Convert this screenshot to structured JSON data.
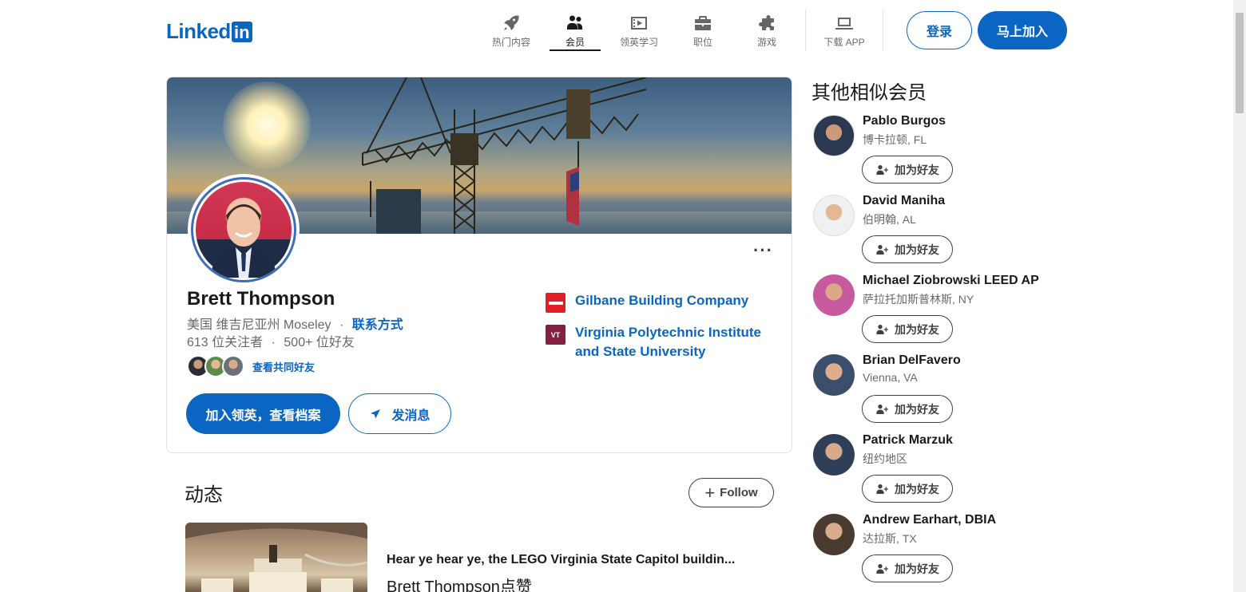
{
  "header": {
    "logo_text": "Linked",
    "logo_in": "in",
    "nav": [
      {
        "label": "热门内容",
        "icon": "rocket-icon"
      },
      {
        "label": "会员",
        "icon": "people-icon",
        "active": true
      },
      {
        "label": "领英学习",
        "icon": "video-play-icon"
      },
      {
        "label": "职位",
        "icon": "briefcase-icon"
      },
      {
        "label": "游戏",
        "icon": "puzzle-icon"
      },
      {
        "label": "下载 APP",
        "icon": "laptop-icon"
      }
    ],
    "login_label": "登录",
    "join_label": "马上加入"
  },
  "profile": {
    "name": "Brett Thompson",
    "location": "美国 维吉尼亚州 Moseley",
    "separator": "·",
    "contact_label": "联系方式",
    "followers": "613 位关注者",
    "connections": "500+ 位好友",
    "mutual_link": "查看共同好友",
    "primary_button": "加入领英，查看档案",
    "message_button": "发消息",
    "more_label": "···",
    "organizations": [
      {
        "name": "Gilbane Building Company",
        "logo": "gilbane-logo",
        "color": "#e41e26"
      },
      {
        "name": "Virginia Polytechnic Institute and State University",
        "logo": "vt-logo",
        "logo_text": "VT",
        "color": "#861f41"
      }
    ]
  },
  "activity": {
    "title": "动态",
    "follow_label": "Follow",
    "follow_plus": "+",
    "post_title": "Hear ye hear ye, the LEGO Virginia State Capitol buildin...",
    "post_sub": "Brett Thompson点赞"
  },
  "sidebar": {
    "title": "其他相似会员",
    "add_label": "加为好友",
    "people": [
      {
        "name": "Pablo Burgos",
        "location": "博卡拉顿, FL"
      },
      {
        "name": "David Maniha",
        "location": "伯明翰, AL"
      },
      {
        "name": "Michael Ziobrowski LEED AP",
        "location": "萨拉托加斯普林斯, NY"
      },
      {
        "name": "Brian DelFavero",
        "location": "Vienna, VA"
      },
      {
        "name": "Patrick Marzuk",
        "location": "纽约地区"
      },
      {
        "name": "Andrew Earhart, DBIA",
        "location": "达拉斯, TX"
      }
    ]
  },
  "colors": {
    "brand": "#0a66c2",
    "text": "#191919",
    "muted": "#666666"
  }
}
